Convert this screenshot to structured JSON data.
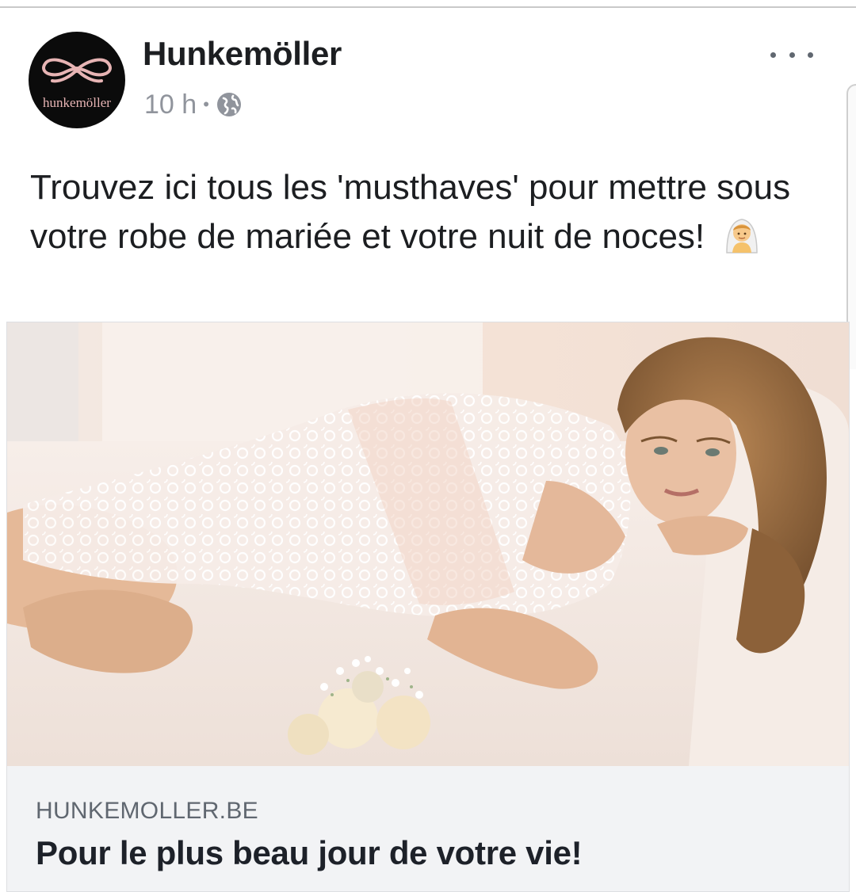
{
  "post": {
    "page_name": "Hunkemöller",
    "avatar_logo_text": "hunkemöller",
    "timestamp": "10 h",
    "separator": "•",
    "privacy_icon": "globe-icon",
    "more_icon": "more-options-icon",
    "text": "Trouvez ici tous les 'musthaves' pour mettre sous votre robe de mariée et votre nuit de noces!",
    "text_emoji": "person-with-veil-emoji"
  },
  "link_preview": {
    "image_subject": "preview-photo",
    "domain": "HUNKEMOLLER.BE",
    "title": "Pour le plus beau jour de votre vie!"
  },
  "colors": {
    "text_primary": "#1c1e21",
    "text_secondary": "#90949c",
    "footer_bg": "#f2f3f5",
    "avatar_bg": "#0b0b0b",
    "logo_pink": "#e7b4b4"
  }
}
